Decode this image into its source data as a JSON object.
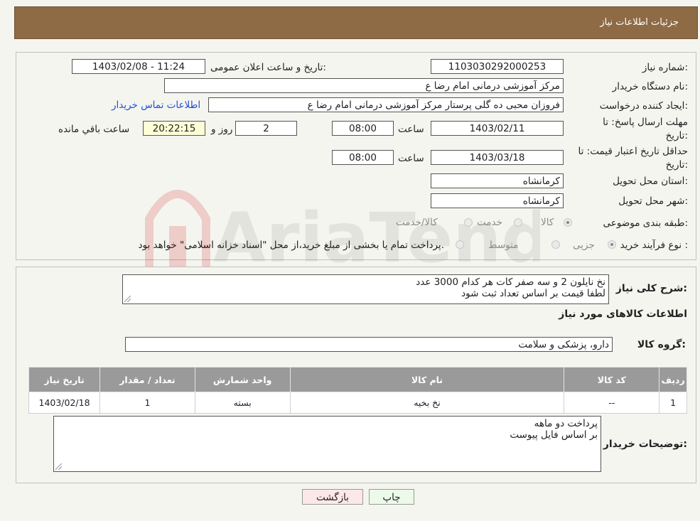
{
  "header": {
    "title": "جزئیات اطلاعات نیاز"
  },
  "form": {
    "need_number_label": "شماره نیاز:",
    "need_number": "1103030292000253",
    "announce_label": "تاریخ و ساعت اعلان عمومی:",
    "announce_value": "1403/02/08 - 11:24",
    "buyer_org_label": "نام دستگاه خریدار:",
    "buyer_org": "مرکز آموزشی  درمانی امام رضا  ع",
    "creator_label": "ایجاد کننده درخواست:",
    "creator": "فروزان محبی ده گلی پرستار مرکز آموزشی  درمانی امام رضا  ع",
    "contact_link": "اطلاعات تماس خریدار",
    "deadline_label": "مهلت ارسال پاسخ: تا تاریخ:",
    "deadline_date": "1403/02/11",
    "time_label": "ساعت",
    "deadline_time": "08:00",
    "days_value": "2",
    "days_label": "روز و",
    "remaining_time": "20:22:15",
    "remaining_label": "ساعت باقي مانده",
    "validity_label": "حداقل تاريخ اعتبار قيمت: تا تاریخ:",
    "validity_date": "1403/03/18",
    "validity_time": "08:00",
    "province_label": "استان محل تحویل:",
    "province": "کرمانشاه",
    "city_label": "شهر محل تحویل:",
    "city": "کرمانشاه",
    "category_label": "طبقه بندی موضوعی:",
    "category_options": [
      "کالا",
      "خدمت",
      "کالا/خدمت"
    ],
    "process_label": "نوع فرآیند خرید :",
    "process_options": [
      "جزیی",
      "متوسط"
    ],
    "process_note": "پرداخت تمام یا بخشی از مبلغ خرید،از محل \"اسناد خزانه اسلامی\" خواهد بود."
  },
  "details": {
    "summary_label": "شرح کلی نیاز:",
    "summary_line1": "نخ نایلون 2 و سه صفر کات   هر کدام      3000 عدد",
    "summary_line2": "لطفا  قیمت بر اساس تعداد ثبت شود",
    "goods_info_title": "اطلاعات کالاهای مورد نیاز",
    "goods_group_label": "گروه کالا:",
    "goods_group": "دارو، پزشکی و سلامت",
    "table": {
      "headers": [
        "ردیف",
        "کد کالا",
        "نام کالا",
        "واحد شمارش",
        "تعداد / مقدار",
        "تاریخ نیاز"
      ],
      "rows": [
        [
          "1",
          "--",
          "نخ بخیه",
          "بسته",
          "1",
          "1403/02/18"
        ]
      ]
    },
    "buyer_notes_label": "توضیحات خریدار:",
    "buyer_notes_line1": "پرداخت دو ماهه",
    "buyer_notes_line2": "بر اساس فایل پیوست"
  },
  "buttons": {
    "print": "چاپ",
    "back": "بازگشت"
  },
  "watermark": "AriaTender.neT"
}
